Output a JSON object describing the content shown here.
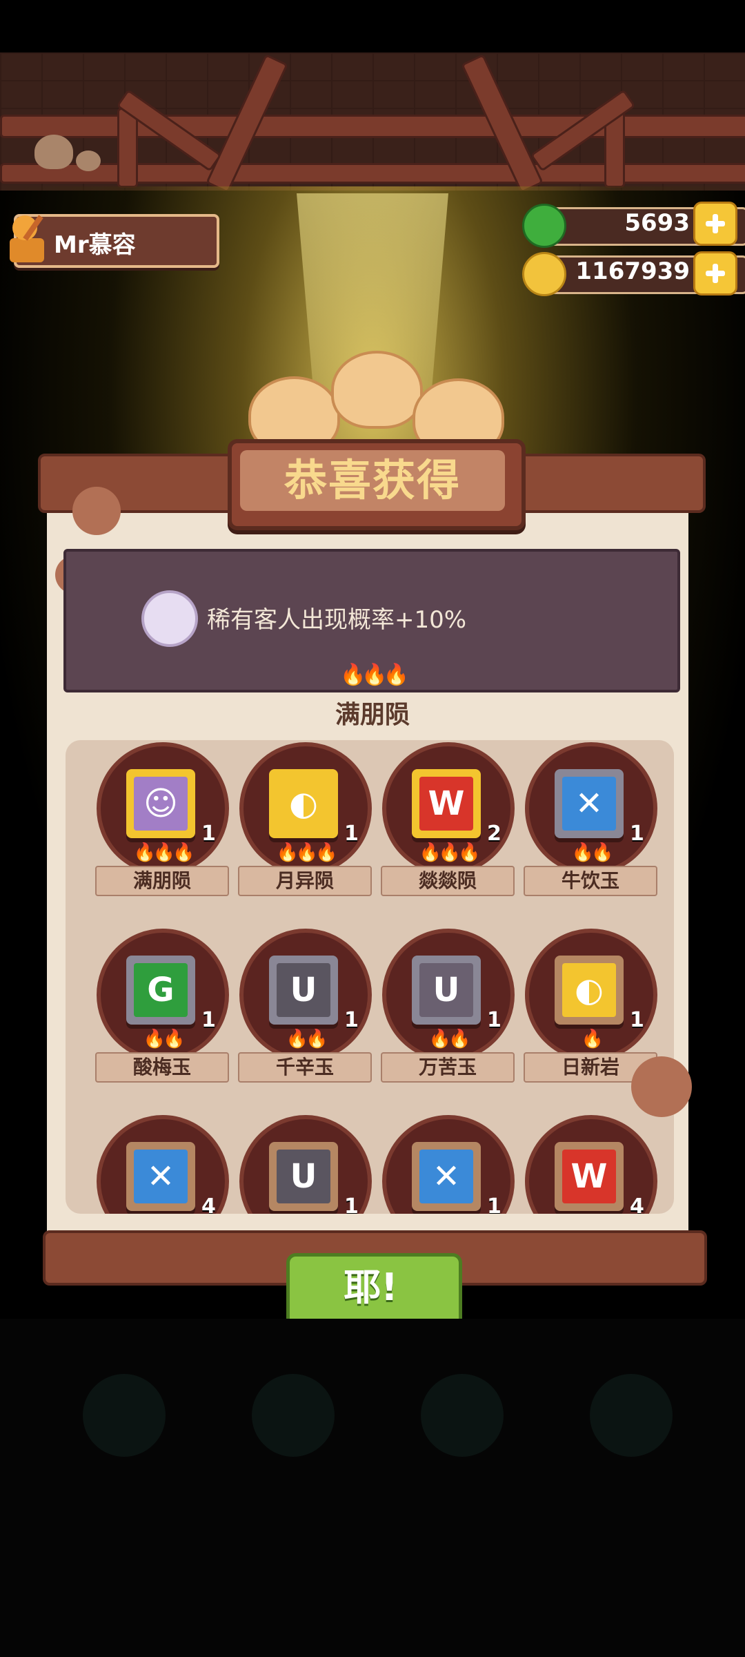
{
  "player": {
    "name": "Mr慕容"
  },
  "currency": {
    "jade": {
      "value": "5693",
      "icon": "jade-coin-icon"
    },
    "coins": {
      "value": "1167939",
      "icon": "gold-coin-icon"
    }
  },
  "reward": {
    "title": "恭喜获得",
    "banner_text": "稀有客人出现概率+10%",
    "set_name": "满朋陨",
    "set_stars": "🔥🔥🔥",
    "confirm_label": "耶!"
  },
  "items": [
    {
      "name": "满朋陨",
      "count": "1",
      "fires": "🔥🔥🔥",
      "color": "#f3c52f",
      "inner": "#a27ec6",
      "glyph": "☺"
    },
    {
      "name": "月异陨",
      "count": "1",
      "fires": "🔥🔥🔥",
      "color": "#f3c52f",
      "inner": "#f3c52f",
      "glyph": "◐"
    },
    {
      "name": "燚燚陨",
      "count": "2",
      "fires": "🔥🔥🔥",
      "color": "#f3c52f",
      "inner": "#d8352a",
      "glyph": "W"
    },
    {
      "name": "牛饮玉",
      "count": "1",
      "fires": "🔥🔥",
      "color": "#8a8796",
      "inner": "#3b8ad8",
      "glyph": "✕"
    },
    {
      "name": "酸梅玉",
      "count": "1",
      "fires": "🔥🔥",
      "color": "#8a8796",
      "inner": "#2f9e3d",
      "glyph": "G"
    },
    {
      "name": "千辛玉",
      "count": "1",
      "fires": "🔥🔥",
      "color": "#8a8796",
      "inner": "#5a5560",
      "glyph": "U"
    },
    {
      "name": "万苦玉",
      "count": "1",
      "fires": "🔥🔥",
      "color": "#8a8796",
      "inner": "#6a6070",
      "glyph": "U"
    },
    {
      "name": "日新岩",
      "count": "1",
      "fires": "🔥",
      "color": "#b58763",
      "inner": "#f3c52f",
      "glyph": "◐"
    },
    {
      "name": "",
      "count": "4",
      "fires": "",
      "color": "#b58763",
      "inner": "#3b8ad8",
      "glyph": "✕"
    },
    {
      "name": "",
      "count": "1",
      "fires": "",
      "color": "#b58763",
      "inner": "#5a5560",
      "glyph": "U"
    },
    {
      "name": "",
      "count": "1",
      "fires": "",
      "color": "#b58763",
      "inner": "#3b8ad8",
      "glyph": "✕"
    },
    {
      "name": "",
      "count": "4",
      "fires": "",
      "color": "#b58763",
      "inner": "#d8352a",
      "glyph": "W"
    }
  ]
}
